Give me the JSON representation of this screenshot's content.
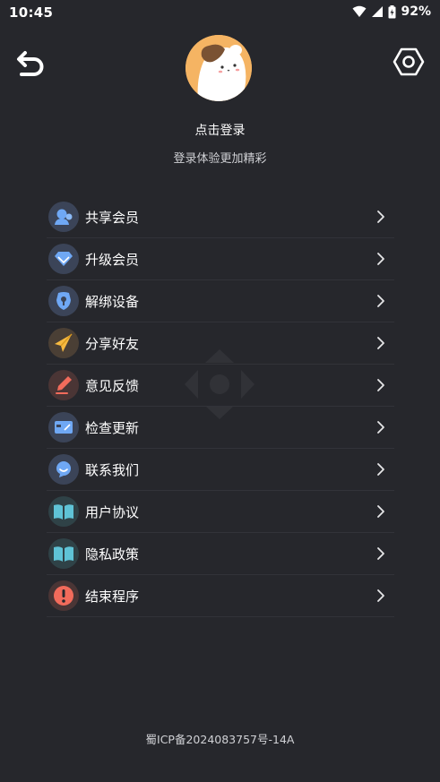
{
  "status_bar": {
    "time": "10:45",
    "battery": "92%"
  },
  "header": {
    "back_icon": "undo-arrow-icon",
    "settings_icon": "hexagon-settings-icon"
  },
  "profile": {
    "login_title": "点击登录",
    "login_subtitle": "登录体验更加精彩"
  },
  "menu": {
    "items": [
      {
        "label": "共享会员",
        "icon": "share-member-icon",
        "icon_bg": "#3b4458",
        "icon_color": "#6fa8f5"
      },
      {
        "label": "升级会员",
        "icon": "diamond-icon",
        "icon_bg": "#3b4458",
        "icon_color": "#6fa8f5"
      },
      {
        "label": "解绑设备",
        "icon": "wrench-icon",
        "icon_bg": "#3b4458",
        "icon_color": "#6fa8f5"
      },
      {
        "label": "分享好友",
        "icon": "paper-plane-icon",
        "icon_bg": "#4a3f35",
        "icon_color": "#f6b940"
      },
      {
        "label": "意见反馈",
        "icon": "pen-icon",
        "icon_bg": "#4a3535",
        "icon_color": "#f26b5b"
      },
      {
        "label": "检查更新",
        "icon": "update-card-icon",
        "icon_bg": "#3b4458",
        "icon_color": "#6fa8f5"
      },
      {
        "label": "联系我们",
        "icon": "chat-bubble-icon",
        "icon_bg": "#3b4458",
        "icon_color": "#6fa8f5"
      },
      {
        "label": "用户协议",
        "icon": "open-book-icon",
        "icon_bg": "#2f4247",
        "icon_color": "#5fc3d6"
      },
      {
        "label": "隐私政策",
        "icon": "open-book-icon",
        "icon_bg": "#2f4247",
        "icon_color": "#5fc3d6"
      },
      {
        "label": "结束程序",
        "icon": "exclamation-icon",
        "icon_bg": "#4a3535",
        "icon_color": "#f26b5b"
      }
    ]
  },
  "footer": {
    "icp": "蜀ICP备2024083757号-14A"
  }
}
